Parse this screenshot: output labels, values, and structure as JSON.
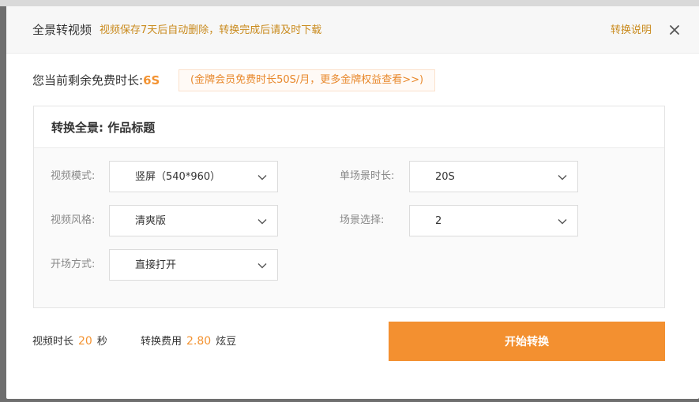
{
  "dialog": {
    "title": "全景转视频",
    "tip": "视频保存7天后自动删除，转换完成后请及时下载",
    "help_link": "转换说明"
  },
  "quota": {
    "label": "您当前剩余免费时长:",
    "value": "6S",
    "promo": "(金牌会员免费时长50S/月，更多金牌权益查看>>)"
  },
  "panel": {
    "title": "转换全景: 作品标题",
    "fields": {
      "video_mode": {
        "label": "视频模式:",
        "value": "竖屏（540*960）"
      },
      "video_style": {
        "label": "视频风格:",
        "value": "清爽版"
      },
      "opening": {
        "label": "开场方式:",
        "value": "直接打开"
      },
      "scene_duration": {
        "label": "单场景时长:",
        "value": "20S"
      },
      "scene_select": {
        "label": "场景选择:",
        "value": "2"
      }
    }
  },
  "footer": {
    "duration_label": "视频时长",
    "duration_value": "20",
    "duration_unit": "秒",
    "cost_label": "转换费用",
    "cost_value": "2.80",
    "cost_unit": "炫豆",
    "start_button": "开始转换"
  },
  "colors": {
    "accent": "#f39030",
    "tip": "#c98a1c"
  },
  "icons": {
    "close": "close-icon",
    "dropdown": "chevron-down-icon"
  }
}
